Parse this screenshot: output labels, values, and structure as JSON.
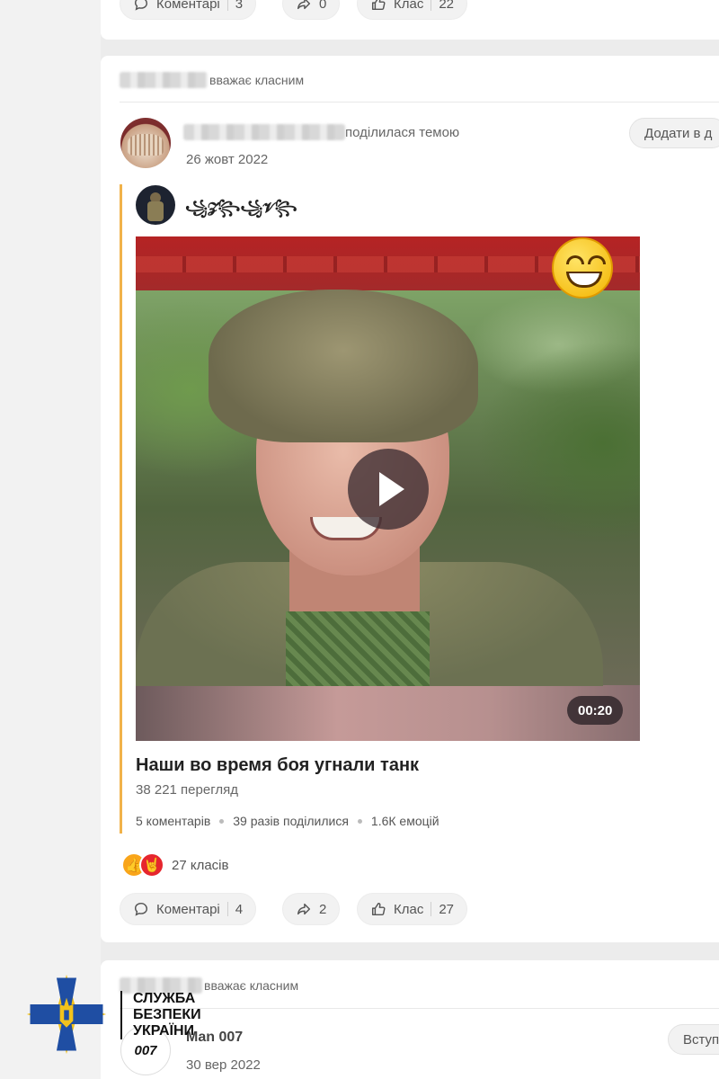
{
  "prev_post": {
    "actions": {
      "comments_label": "Коментарі",
      "comments_count": "3",
      "shares_count": "0",
      "likes_label": "Клас",
      "likes_count": "22"
    }
  },
  "post": {
    "liked_by_suffix": "вважає класним",
    "author_action": "поділилася темою",
    "date": "26 жовт 2022",
    "add_button": "Додати в д",
    "shared": {
      "group_name": "꧁𝓩꧂꧁𝓥꧂",
      "video": {
        "duration": "00:20",
        "title": "Наши во время боя угнали танк",
        "views": "38 221 перегляд"
      },
      "stats": {
        "comments": "5 коментарів",
        "shares": "39 разів поділилися",
        "emotions": "1.6К емоцій"
      }
    },
    "reactions_count": "27 класів",
    "actions": {
      "comments_label": "Коментарі",
      "comments_count": "4",
      "shares_count": "2",
      "likes_label": "Клас",
      "likes_count": "27"
    }
  },
  "next_post": {
    "liked_by_suffix": "вважає класним",
    "author": "Man 007",
    "avatar_text": "007",
    "date": "30 вер 2022",
    "join_button": "Вступ"
  },
  "watermark": {
    "line1": "СЛУЖБА",
    "line2": "БЕЗПЕКИ",
    "line3": "УКРАЇНИ"
  },
  "colors": {
    "share_accent": "#f1b24a",
    "class_orange": "#f9a51a",
    "sbu_blue": "#1f4ea3",
    "sbu_gold": "#f2c21b"
  }
}
